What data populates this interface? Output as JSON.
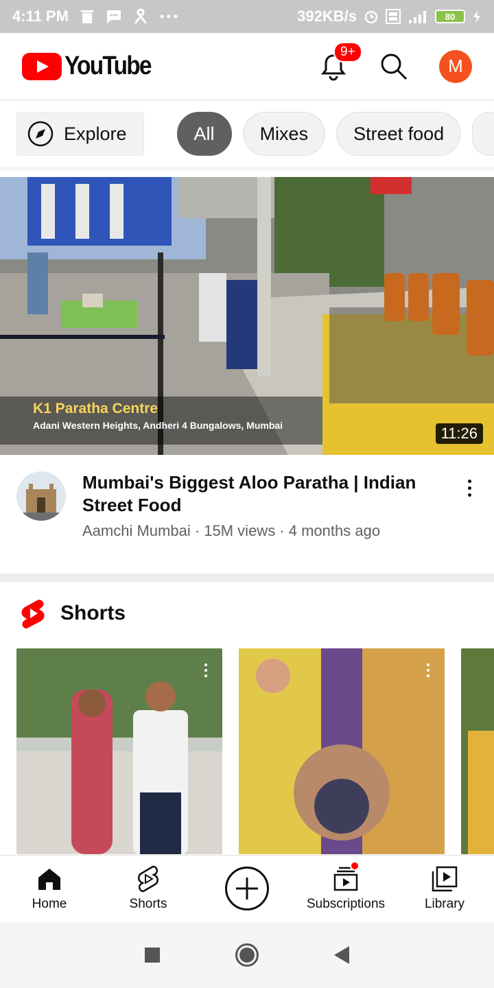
{
  "status_bar": {
    "time": "4:11 PM",
    "speed": "392KB/s",
    "battery": "80",
    "icons": [
      "trash-icon",
      "message-icon",
      "person-icon",
      "more-dots-icon",
      "alarm-icon",
      "volte-icon",
      "signal-icon",
      "battery-icon",
      "charging-icon"
    ]
  },
  "header": {
    "logo_text": "YouTube",
    "notification_badge": "9+",
    "avatar_letter": "M",
    "colors": {
      "brand": "#ff0000",
      "avatar": "#f4511e"
    }
  },
  "chips": {
    "explore": "Explore",
    "items": [
      "All",
      "Mixes",
      "Street food"
    ],
    "active": "All"
  },
  "video": {
    "overlay_title": "K1 Paratha Centre",
    "overlay_subtitle": "Adani Western Heights, Andheri 4 Bungalows, Mumbai",
    "duration": "11:26",
    "title": "Mumbai's Biggest Aloo Paratha | Indian Street Food",
    "channel_meta": "Aamchi Mumbai · 15M views · 4 months ago"
  },
  "shorts": {
    "title": "Shorts"
  },
  "bottom_nav": {
    "home": "Home",
    "shorts": "Shorts",
    "subscriptions": "Subscriptions",
    "library": "Library"
  }
}
